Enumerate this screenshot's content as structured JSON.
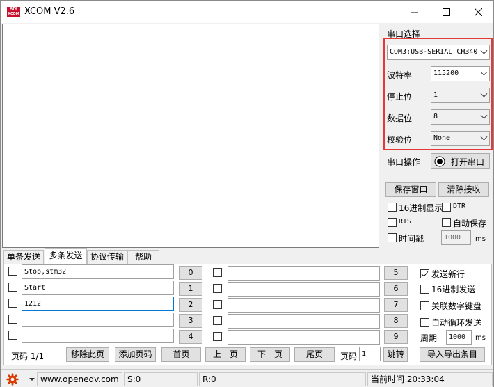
{
  "window": {
    "logo_text": "ATK XCOM",
    "title": "XCOM V2.6",
    "minimize_glyph": "—",
    "maximize_glyph": "☐",
    "close_glyph": "✕"
  },
  "serial": {
    "group_label": "串口选择",
    "port_value": "COM3:USB-SERIAL CH340",
    "baud_label": "波特率",
    "baud_value": "115200",
    "stop_label": "停止位",
    "stop_value": "1",
    "data_label": "数据位",
    "data_value": "8",
    "parity_label": "校验位",
    "parity_value": "None",
    "op_label": "串口操作",
    "open_button": "打开串口"
  },
  "actions": {
    "save_window": "保存窗口",
    "clear_recv": "清除接收",
    "hex_display": "16进制显示",
    "dtr": "DTR",
    "rts": "RTS",
    "auto_save": "自动保存",
    "timestamp": "时间戳",
    "timestamp_value": "1000",
    "timestamp_unit": "ms"
  },
  "tabs": [
    "单条发送",
    "多条发送",
    "协议传输",
    "帮助"
  ],
  "multi_send": {
    "left_rows": [
      {
        "text": "Stop,stm32",
        "num": "0"
      },
      {
        "text": "Start",
        "num": "1"
      },
      {
        "text": "1212",
        "num": "2"
      },
      {
        "text": "",
        "num": "3"
      },
      {
        "text": "",
        "num": "4"
      }
    ],
    "right_rows": [
      {
        "text": "",
        "num": "5"
      },
      {
        "text": "",
        "num": "6"
      },
      {
        "text": "",
        "num": "7"
      },
      {
        "text": "",
        "num": "8"
      },
      {
        "text": "",
        "num": "9"
      }
    ],
    "options": {
      "send_newline": "发送新行",
      "hex_send": "16进制发送",
      "link_numpad": "关联数字键盘",
      "auto_loop": "自动循环发送",
      "period_label": "周期",
      "period_value": "1000",
      "period_unit": "ms"
    },
    "page_label": "页码 1/1",
    "remove_page": "移除此页",
    "add_page": "添加页码",
    "first_page": "首页",
    "prev_page": "上一页",
    "next_page": "下一页",
    "last_page": "尾页",
    "page_input_label": "页码",
    "page_input_value": "1",
    "jump": "跳转",
    "import_export": "导入导出条目"
  },
  "status": {
    "url": "www.openedv.com",
    "sent": "S:0",
    "recv": "R:0",
    "time_label": "当前时间",
    "time": "20:33:04"
  },
  "colors": {
    "highlight_border": "#e53935",
    "logo_red": "#c8102e",
    "gear_red": "#d83b01"
  }
}
